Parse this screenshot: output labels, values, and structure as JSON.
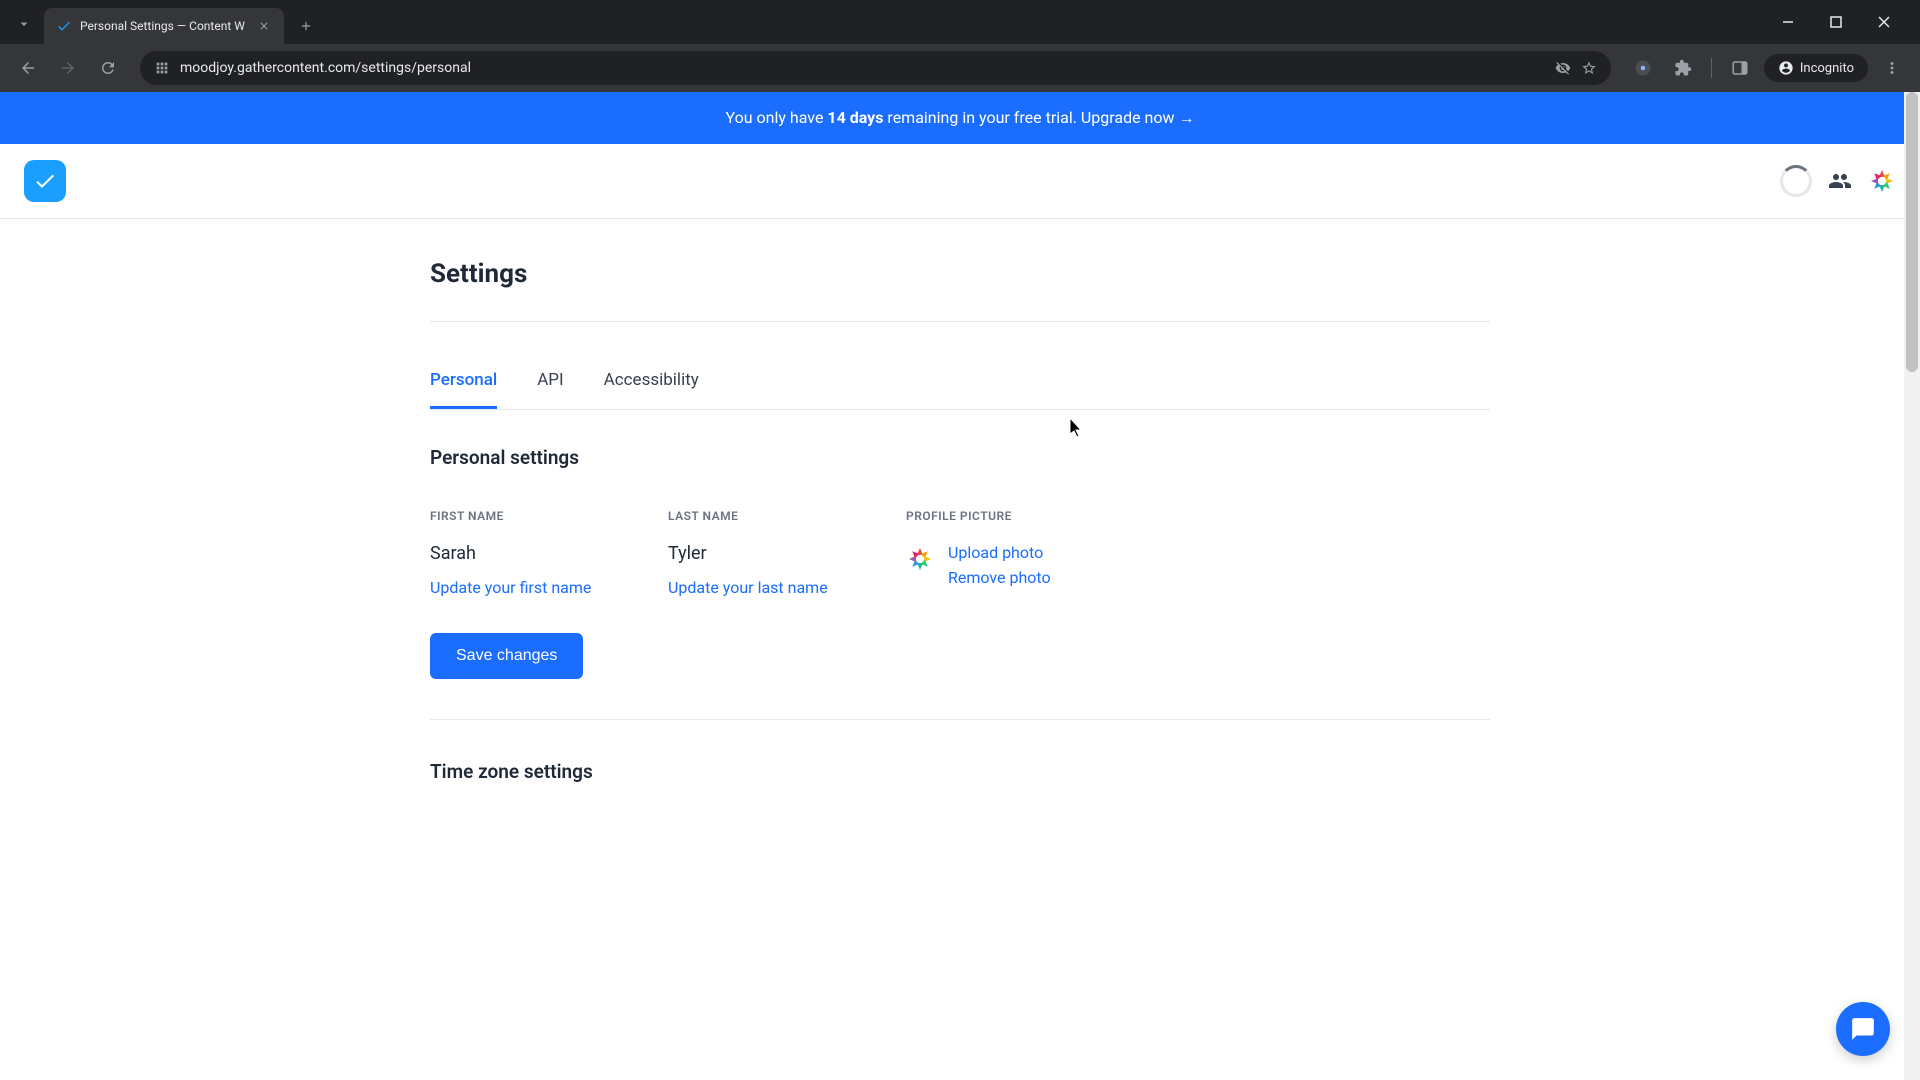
{
  "browser": {
    "tab_title": "Personal Settings — Content W",
    "url": "moodjoy.gathercontent.com/settings/personal",
    "incognito_label": "Incognito"
  },
  "banner": {
    "prefix": "You only have ",
    "days": "14 days",
    "suffix": " remaining in your free trial. Upgrade now →"
  },
  "page": {
    "title": "Settings",
    "tabs": [
      {
        "label": "Personal",
        "active": true
      },
      {
        "label": "API",
        "active": false
      },
      {
        "label": "Accessibility",
        "active": false
      }
    ],
    "section_personal": "Personal settings",
    "section_timezone": "Time zone settings",
    "first_name_label": "FIRST NAME",
    "first_name_value": "Sarah",
    "first_name_link": "Update your first name",
    "last_name_label": "LAST NAME",
    "last_name_value": "Tyler",
    "last_name_link": "Update your last name",
    "profile_label": "PROFILE PICTURE",
    "upload_link": "Upload photo",
    "remove_link": "Remove photo",
    "save_button": "Save changes"
  },
  "colors": {
    "primary": "#1a6dff",
    "logo": "#1a9fff"
  }
}
